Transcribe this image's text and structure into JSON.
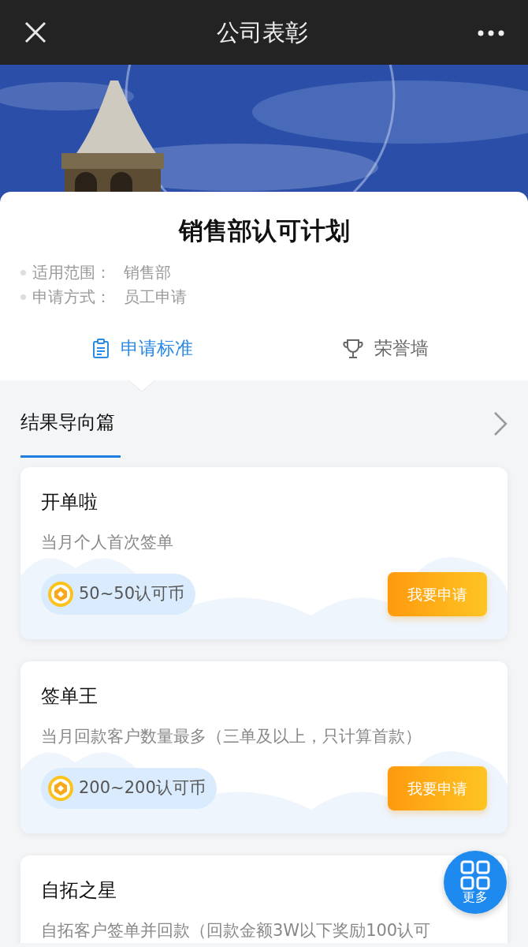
{
  "window": {
    "title": "公司表彰"
  },
  "plan": {
    "title": "销售部认可计划",
    "info": [
      {
        "label": "适用范围：",
        "value": "销售部"
      },
      {
        "label": "申请方式：",
        "value": "员工申请"
      }
    ]
  },
  "tabs": [
    {
      "label": "申请标准",
      "selected": true
    },
    {
      "label": "荣誉墙",
      "selected": false
    }
  ],
  "section": {
    "title": "结果导向篇"
  },
  "awards": [
    {
      "title": "开单啦",
      "description": "当月个人首次签单",
      "reward": "50~50认可币",
      "button": "我要申请"
    },
    {
      "title": "签单王",
      "description": "当月回款客户数量最多（三单及以上，只计算首款）",
      "reward": "200~200认可币",
      "button": "我要申请"
    },
    {
      "title": "自拓之星",
      "description": "自拓客户签单并回款（回款金额3W以下奖励100认可"
    }
  ],
  "fab": {
    "label": "更多"
  }
}
